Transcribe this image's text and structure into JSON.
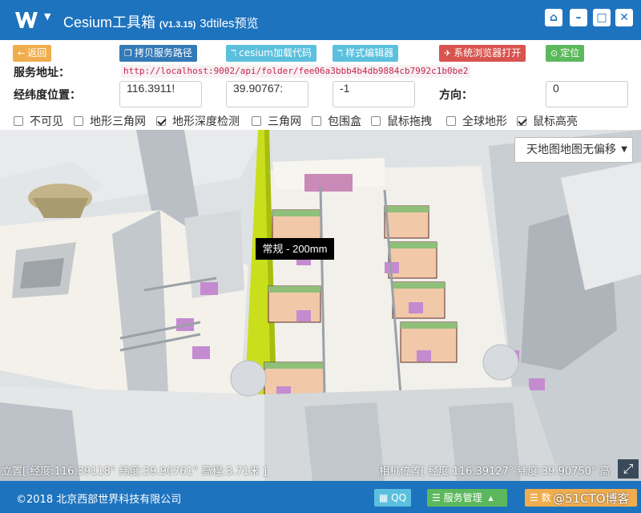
{
  "app": {
    "title": "Cesium工具箱",
    "version": "(V1.3.15)",
    "subtitle": "3dtiles预览",
    "window_buttons": [
      "home-icon",
      "minimize-icon",
      "maximize-icon",
      "close-icon"
    ]
  },
  "toolbar": {
    "back_label": "返回",
    "copy_path_label": "拷贝服务路径",
    "cesium_code_label": "cesium加载代码",
    "style_editor_label": "样式编辑器",
    "open_browser_label": "系统浏览器打开",
    "locate_label": "定位"
  },
  "service": {
    "label": "服务地址：",
    "url": "http://localhost:9002/api/folder/fee06a3bbb4b4db9884cb7992c1b0be2"
  },
  "position": {
    "label": "经纬度位置：",
    "lon": "116.3911!",
    "lat": "39.90767:",
    "height": "-1",
    "heading_label": "方向：",
    "heading": "0"
  },
  "checkboxes": [
    {
      "label": "不可见",
      "checked": false
    },
    {
      "label": "地形三角网",
      "checked": false
    },
    {
      "label": "地形深度检测",
      "checked": true
    },
    {
      "label": "三角网",
      "checked": false
    },
    {
      "label": "包围盒",
      "checked": false
    },
    {
      "label": "鼠标拖拽",
      "checked": false
    },
    {
      "label": "全球地形",
      "checked": false
    },
    {
      "label": "鼠标高亮",
      "checked": true
    }
  ],
  "viewer": {
    "basemap": "天地图地图无偏移",
    "tooltip": "常规 - 200mm",
    "mouse_pos": "立置[ 经度:116.39118° 纬度:39.90761° 高程:3.71米 ]",
    "camera_pos": "相机位置[ 经度:116.39127° 纬度:39.90750° 高"
  },
  "footer": {
    "copyright": "©2018 北京西部世界科技有限公司",
    "qq_label": "QQ",
    "service_mgmt_label": "服务管理",
    "data_label": "数",
    "watermark": "@51CTO博客"
  },
  "colors": {
    "primary": "#1e73be",
    "back": "#f0ad4e",
    "dark": "#337ab7",
    "info": "#5bc0de",
    "danger": "#d9534f",
    "success": "#5cb85c"
  }
}
